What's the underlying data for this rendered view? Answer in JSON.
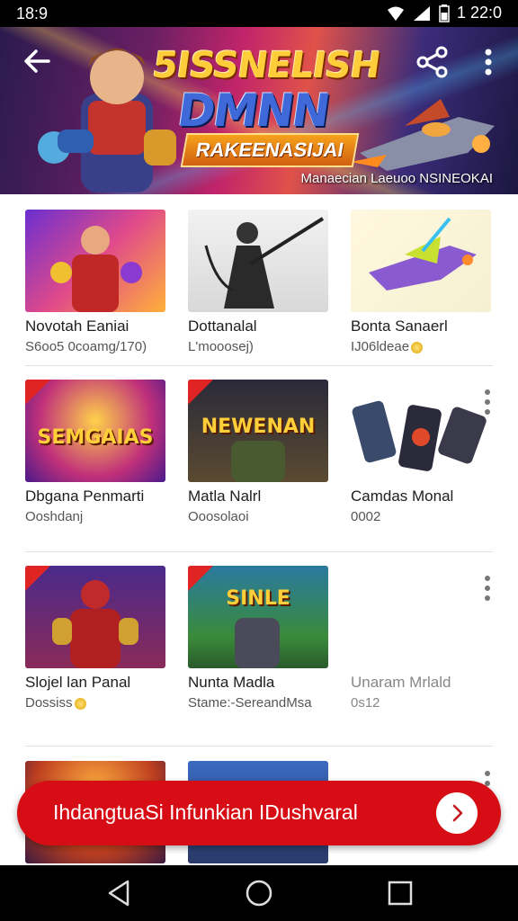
{
  "status_bar": {
    "time": "18:9",
    "clock": "1 22:0",
    "icons": [
      "wifi-icon",
      "signal-icon",
      "battery-icon"
    ]
  },
  "hero": {
    "title_line1": "5ISSNELISH",
    "title_line2": "DMNN",
    "ribbon": "RAKEENASIJAI",
    "caption": "Manaecian Laeuoo NSINEOKAI",
    "buttons": [
      "back-icon",
      "share-icon",
      "more-vert-icon"
    ]
  },
  "rows": [
    {
      "cards": [
        {
          "title": "Novotah Eaniai",
          "subtitle": "S6oo5 0coamg/170)",
          "thumb_text": ""
        },
        {
          "title": "Dottanalal",
          "subtitle": "L'mooosej)",
          "thumb_text": ""
        },
        {
          "title": "Bonta Sanaerl",
          "subtitle": "IJ06ldeae",
          "thumb_text": ""
        }
      ]
    },
    {
      "cards": [
        {
          "title": "Dbgana Penmarti",
          "subtitle": "Ooshdanj",
          "thumb_text": "SEMGAIAS"
        },
        {
          "title": "Matla Nalrl",
          "subtitle": "Ooosolaoi",
          "thumb_text": "NEWENAN"
        },
        {
          "title": "Camdas Monal",
          "subtitle": "0002",
          "thumb_text": ""
        }
      ]
    },
    {
      "cards": [
        {
          "title": "Slojel lan Panal",
          "subtitle": "Dossiss",
          "thumb_text": ""
        },
        {
          "title": "Nunta Madla",
          "subtitle": "Stame:-SereandMsa",
          "thumb_text": "SINLE"
        },
        {
          "title": "Unaram Mrlald",
          "subtitle": "0s12",
          "thumb_text": ""
        }
      ]
    }
  ],
  "cta": {
    "label": "IhdangtuaSi Infunkian IDushvaral",
    "icon": "chevron-right-icon"
  },
  "nav": {
    "icons": [
      "nav-back-icon",
      "nav-home-icon",
      "nav-recents-icon"
    ]
  },
  "colors": {
    "cta": "#d60d14",
    "status_bar": "#000000",
    "divider": "#e2e2e2"
  }
}
